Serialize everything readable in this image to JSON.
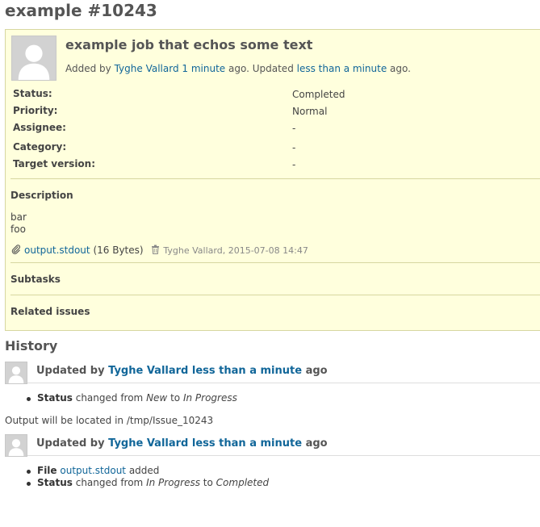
{
  "page_title": "example #10243",
  "issue": {
    "subject": "example job that echos some text",
    "author_line": {
      "prefix": "Added by ",
      "author": "Tyghe Vallard",
      "space": " ",
      "added_ago": "1 minute",
      "middle": " ago. Updated ",
      "updated_ago": "less than a minute",
      "suffix": " ago."
    },
    "attributes": [
      {
        "label": "Status:",
        "value": "Completed"
      },
      {
        "label": "Priority:",
        "value": "Normal"
      },
      {
        "label": "Assignee:",
        "value": "-"
      },
      {
        "label": "Category:",
        "value": "-"
      },
      {
        "label": "Target version:",
        "value": "-"
      }
    ],
    "description_heading": "Description",
    "description_lines": [
      "bar",
      "foo"
    ],
    "attachment": {
      "filename": "output.stdout",
      "size": "(16 Bytes)",
      "meta": "Tyghe Vallard, 2015-07-08 14:47",
      "icons": [
        "paperclip-icon",
        "trash-icon"
      ]
    },
    "subtasks_heading": "Subtasks",
    "related_heading": "Related issues"
  },
  "history": {
    "title": "History",
    "journals": [
      {
        "updated_by": "Updated by",
        "author": "Tyghe Vallard",
        "ago_link": "less than a minute",
        "ago": "ago",
        "details": [
          {
            "field": "Status",
            "text1": " changed from ",
            "old": "New",
            "text2": " to ",
            "new": "In Progress"
          }
        ],
        "note": "Output will be located in /tmp/Issue_10243"
      },
      {
        "updated_by": "Updated by",
        "author": "Tyghe Vallard",
        "ago_link": "less than a minute",
        "ago": "ago",
        "details_file": {
          "field": "File",
          "link": "output.stdout",
          "text": " added"
        },
        "details": [
          {
            "field": "Status",
            "text1": " changed from ",
            "old": "In Progress",
            "text2": " to ",
            "new": "Completed"
          }
        ]
      }
    ]
  },
  "colors": {
    "link": "#116699",
    "box_bg": "#ffffdd",
    "box_border": "#d7d7a0"
  }
}
